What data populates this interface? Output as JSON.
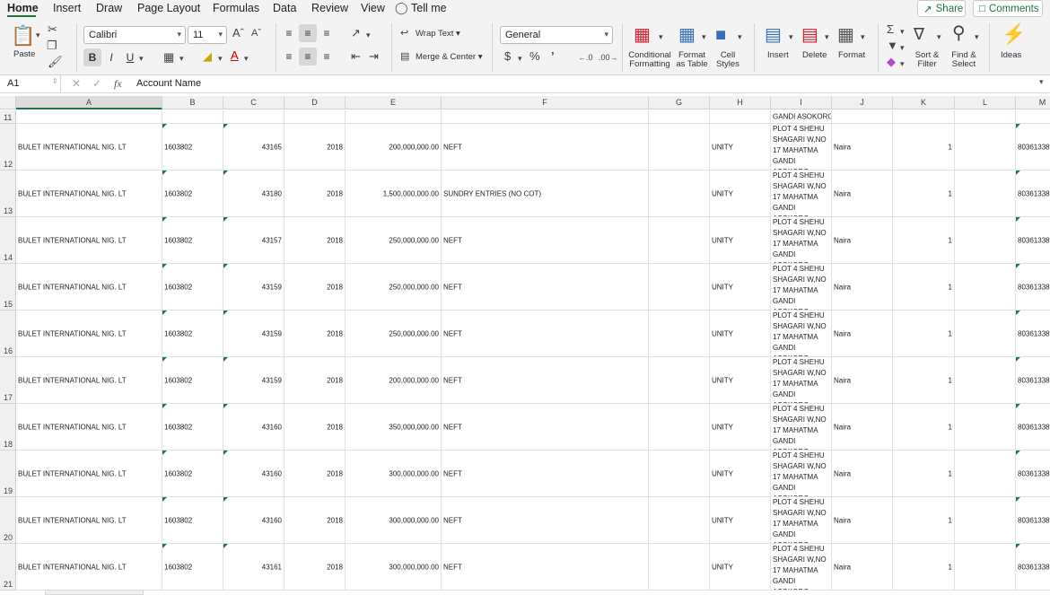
{
  "tabs": [
    "Home",
    "Insert",
    "Draw",
    "Page Layout",
    "Formulas",
    "Data",
    "Review",
    "View",
    "Tell me"
  ],
  "share_label": "Share",
  "comments_label": "Comments",
  "ribbon": {
    "paste": "Paste",
    "font_name": "Calibri",
    "font_size": "11",
    "wrap_text": "Wrap Text",
    "merge_center": "Merge & Center",
    "number_format": "General",
    "cond_fmt": [
      "Conditional",
      "Formatting"
    ],
    "fmt_table": [
      "Format",
      "as Table"
    ],
    "cell_styles": [
      "Cell",
      "Styles"
    ],
    "insert": "Insert",
    "delete": "Delete",
    "format": "Format",
    "sort_filter": [
      "Sort &",
      "Filter"
    ],
    "find_select": [
      "Find &",
      "Select"
    ],
    "ideas": "Ideas"
  },
  "formula_bar": {
    "name_box": "A1",
    "value": "Account Name"
  },
  "columns": [
    "A",
    "B",
    "C",
    "D",
    "E",
    "F",
    "G",
    "H",
    "I",
    "J",
    "K",
    "L",
    "M"
  ],
  "first_row": {
    "num": "11",
    "i": "GANDI ASOKORO"
  },
  "address_lines": [
    "PLOT 4   SHEHU",
    "SHAGARI  W,NO",
    "17 MAHATMA",
    "GANDI ASOKORO"
  ],
  "rows": [
    {
      "num": "12",
      "a": "BULET  INTERNATIONAL  NIG.  LT",
      "b": "1603802",
      "c": "43165",
      "d": "2018",
      "e": "200,000,000.00",
      "f": "NEFT",
      "h": "UNITY",
      "j": "Naira",
      "k": "1",
      "m": "80361338"
    },
    {
      "num": "13",
      "a": "BULET  INTERNATIONAL  NIG.  LT",
      "b": "1603802",
      "c": "43180",
      "d": "2018",
      "e": "1,500,000,000.00",
      "f": "SUNDRY ENTRIES (NO COT)",
      "h": "UNITY",
      "j": "Naira",
      "k": "1",
      "m": "80361338"
    },
    {
      "num": "14",
      "a": "BULET  INTERNATIONAL  NIG.  LT",
      "b": "1603802",
      "c": "43157",
      "d": "2018",
      "e": "250,000,000.00",
      "f": "NEFT",
      "h": "UNITY",
      "j": "Naira",
      "k": "1",
      "m": "80361338"
    },
    {
      "num": "15",
      "a": "BULET  INTERNATIONAL  NIG.  LT",
      "b": "1603802",
      "c": "43159",
      "d": "2018",
      "e": "250,000,000.00",
      "f": "NEFT",
      "h": "UNITY",
      "j": "Naira",
      "k": "1",
      "m": "80361338"
    },
    {
      "num": "16",
      "a": "BULET  INTERNATIONAL  NIG.  LT",
      "b": "1603802",
      "c": "43159",
      "d": "2018",
      "e": "250,000,000.00",
      "f": "NEFT",
      "h": "UNITY",
      "j": "Naira",
      "k": "1",
      "m": "80361338"
    },
    {
      "num": "17",
      "a": "BULET  INTERNATIONAL  NIG.  LT",
      "b": "1603802",
      "c": "43159",
      "d": "2018",
      "e": "200,000,000.00",
      "f": "NEFT",
      "h": "UNITY",
      "j": "Naira",
      "k": "1",
      "m": "80361338"
    },
    {
      "num": "18",
      "a": "BULET  INTERNATIONAL  NIG.  LT",
      "b": "1603802",
      "c": "43160",
      "d": "2018",
      "e": "350,000,000.00",
      "f": "NEFT",
      "h": "UNITY",
      "j": "Naira",
      "k": "1",
      "m": "80361338"
    },
    {
      "num": "19",
      "a": "BULET  INTERNATIONAL  NIG.  LT",
      "b": "1603802",
      "c": "43160",
      "d": "2018",
      "e": "300,000,000.00",
      "f": "NEFT",
      "h": "UNITY",
      "j": "Naira",
      "k": "1",
      "m": "80361338"
    },
    {
      "num": "20",
      "a": "BULET  INTERNATIONAL  NIG.  LT",
      "b": "1603802",
      "c": "43160",
      "d": "2018",
      "e": "300,000,000.00",
      "f": "NEFT",
      "h": "UNITY",
      "j": "Naira",
      "k": "1",
      "m": "80361338"
    },
    {
      "num": "21",
      "a": "BULET  INTERNATIONAL  NIG.  LT",
      "b": "1603802",
      "c": "43161",
      "d": "2018",
      "e": "300,000,000.00",
      "f": "NEFT",
      "h": "UNITY",
      "j": "Naira",
      "k": "1",
      "m": "80361338"
    }
  ],
  "colors": {
    "accent": "#217346",
    "triangle": "#1f7a3e"
  }
}
